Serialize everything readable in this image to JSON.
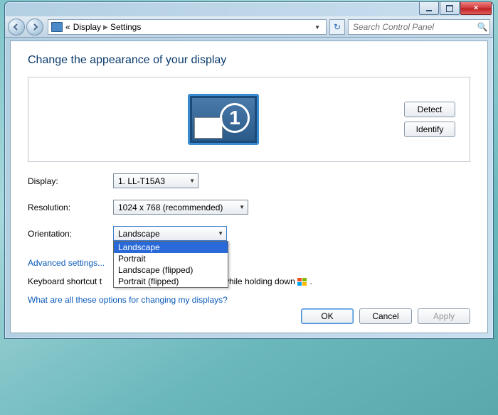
{
  "breadcrumb": {
    "item1": "Display",
    "item2": "Settings",
    "icon_label": "«"
  },
  "search": {
    "placeholder": "Search Control Panel"
  },
  "page": {
    "title": "Change the appearance of your display"
  },
  "preview": {
    "monitor_number": "1"
  },
  "buttons": {
    "detect": "Detect",
    "identify": "Identify",
    "ok": "OK",
    "cancel": "Cancel",
    "apply": "Apply"
  },
  "fields": {
    "display_label": "Display:",
    "display_value": "1. LL-T15A3",
    "resolution_label": "Resolution:",
    "resolution_value": "1024 x 768 (recommended)",
    "orientation_label": "Orientation:",
    "orientation_value": "Landscape",
    "orientation_options": [
      "Landscape",
      "Portrait",
      "Landscape (flipped)",
      "Portrait (flipped)"
    ]
  },
  "links": {
    "advanced": "Advanced settings...",
    "help": "What are all these options for changing my displays?"
  },
  "kbd": {
    "prefix": "Keyboard shortcut t",
    "suffix": "Tap P while holding down",
    "period": "."
  }
}
